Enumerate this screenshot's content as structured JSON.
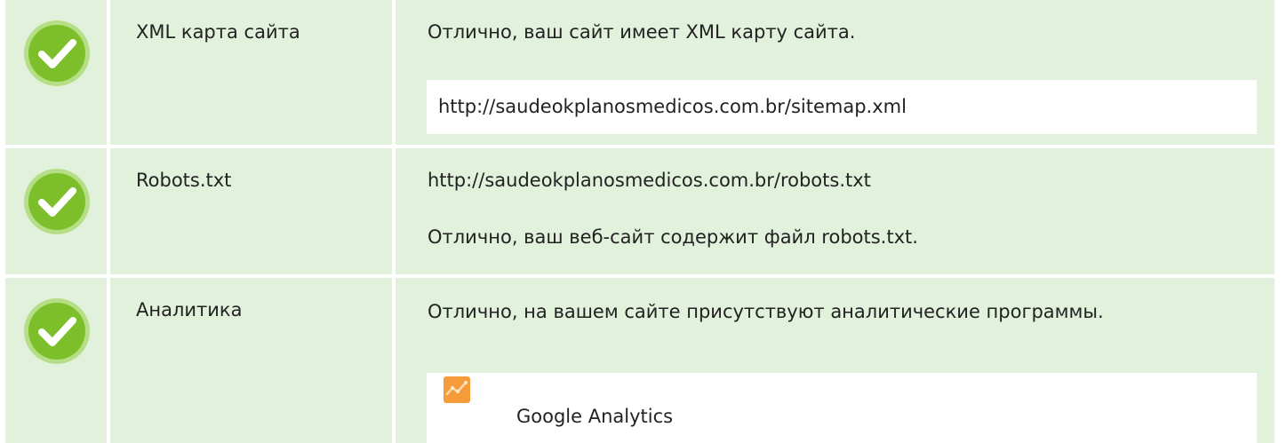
{
  "rows": [
    {
      "label": "XML карта сайта",
      "status": "pass",
      "message": "Отлично, ваш сайт имеет XML карту сайта.",
      "url": "http://saudeokplanosmedicos.com.br/sitemap.xml"
    },
    {
      "label": "Robots.txt",
      "status": "pass",
      "url": "http://saudeokplanosmedicos.com.br/robots.txt",
      "message": "Отлично, ваш веб-сайт содержит файл robots.txt."
    },
    {
      "label": "Аналитика",
      "status": "pass",
      "message": "Отлично, на вашем сайте присутствуют аналитические программы.",
      "tool": {
        "name": "Google Analytics",
        "icon": "google-analytics-icon"
      }
    }
  ],
  "colors": {
    "cell_background": "#e1f1dc",
    "check_green": "#7cbf2a",
    "check_border": "#b5de86",
    "analytics_orange": "#f59b3a"
  },
  "icons": {
    "status": "check-circle-icon"
  }
}
